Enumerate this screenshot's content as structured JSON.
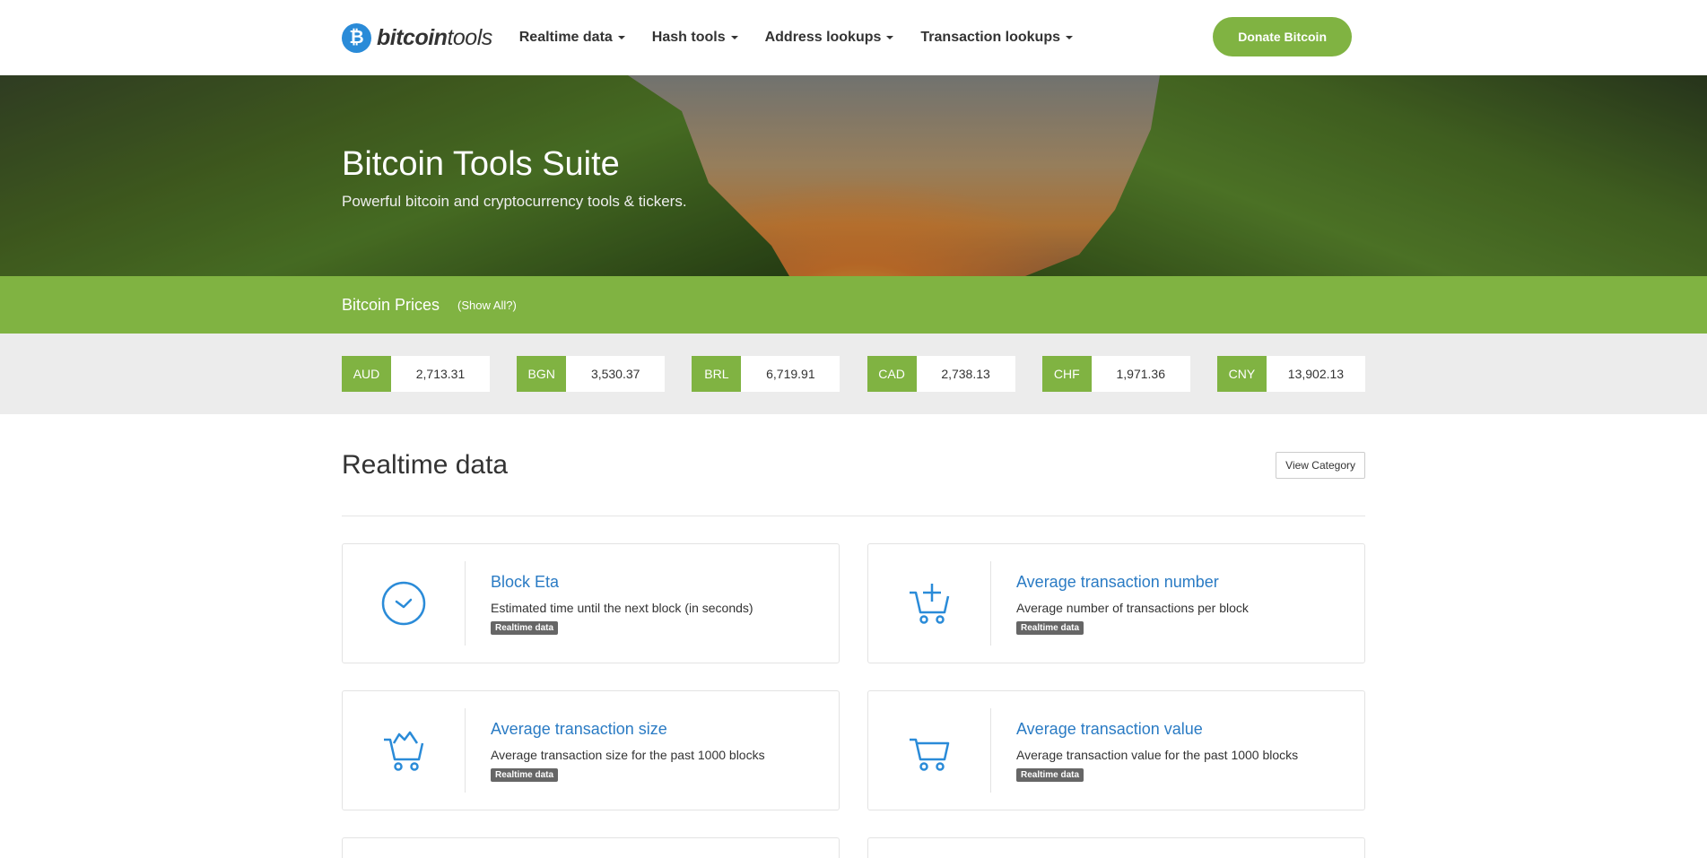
{
  "brand": {
    "bold": "bitcoin",
    "light": "tools",
    "icon": "bitcoin-logo-icon"
  },
  "nav": {
    "items": [
      {
        "label": "Realtime data"
      },
      {
        "label": "Hash tools"
      },
      {
        "label": "Address lookups"
      },
      {
        "label": "Transaction lookups"
      }
    ],
    "donate_label": "Donate Bitcoin"
  },
  "hero": {
    "title": "Bitcoin Tools Suite",
    "subtitle": "Powerful bitcoin and cryptocurrency tools & tickers."
  },
  "prices": {
    "title": "Bitcoin Prices",
    "show_all": "(Show All?)",
    "tickers": [
      {
        "currency": "AUD",
        "value": "2,713.31"
      },
      {
        "currency": "BGN",
        "value": "3,530.37"
      },
      {
        "currency": "BRL",
        "value": "6,719.91"
      },
      {
        "currency": "CAD",
        "value": "2,738.13"
      },
      {
        "currency": "CHF",
        "value": "1,971.36"
      },
      {
        "currency": "CNY",
        "value": "13,902.13"
      }
    ]
  },
  "section": {
    "title": "Realtime data",
    "view_label": "View Category",
    "cards": [
      {
        "title": "Block Eta",
        "desc": "Estimated time until the next block (in seconds)",
        "badge": "Realtime data",
        "icon": "clock-icon"
      },
      {
        "title": "Average transaction number",
        "desc": "Average number of transactions per block",
        "badge": "Realtime data",
        "icon": "cart-add-icon"
      },
      {
        "title": "Average transaction size",
        "desc": "Average transaction size for the past 1000 blocks",
        "badge": "Realtime data",
        "icon": "cart-full-icon"
      },
      {
        "title": "Average transaction value",
        "desc": "Average transaction value for the past 1000 blocks",
        "badge": "Realtime data",
        "icon": "cart-icon"
      }
    ]
  },
  "colors": {
    "accent": "#80b342",
    "link": "#2a7bc4",
    "icon": "#2a8bd8"
  }
}
